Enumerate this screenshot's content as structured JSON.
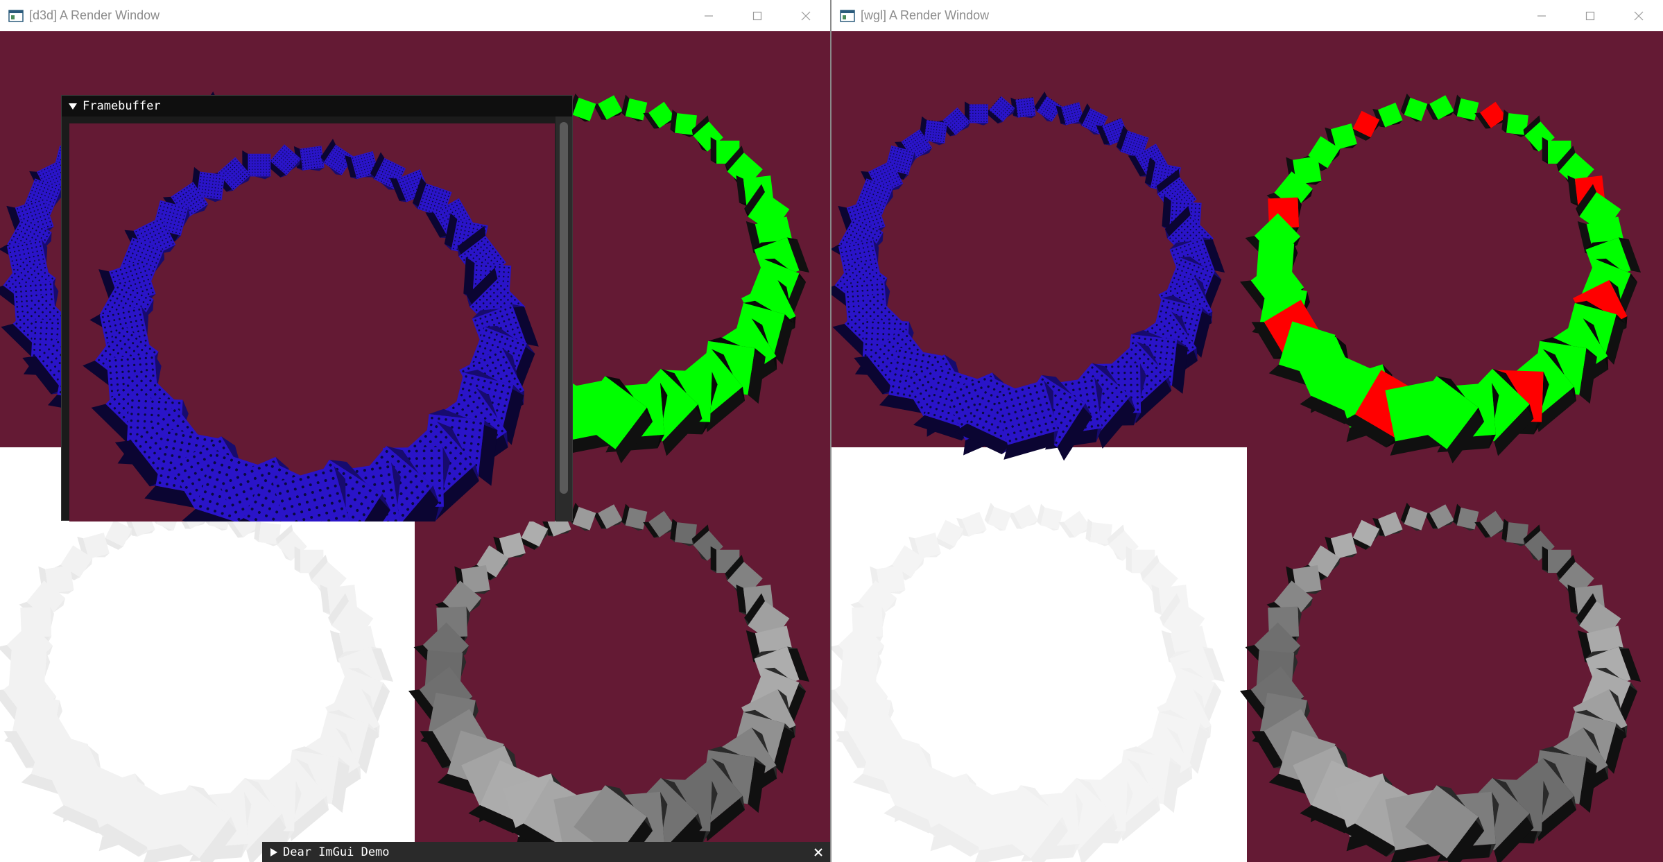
{
  "windows": [
    {
      "title": "[d3d] A Render Window",
      "icon": "app-window-icon",
      "controls": [
        "minimize-icon",
        "maximize-icon",
        "close-icon"
      ]
    },
    {
      "title": "[wgl] A Render Window",
      "icon": "app-window-icon",
      "controls": [
        "minimize-icon",
        "maximize-icon",
        "close-icon"
      ]
    }
  ],
  "imgui": {
    "framebuffer_title": "Framebuffer",
    "demo_title": "Dear ImGui Demo"
  },
  "colors": {
    "background": "#641a34",
    "cube_blue": "#2a14c8",
    "cube_green": "#00ff00",
    "cube_red": "#ff0000",
    "cube_gray": "#a5a5a5",
    "cube_white": "#f2f2f2",
    "imgui_title": "#0f0f0f",
    "imgui_window": "#1b1b1b"
  }
}
